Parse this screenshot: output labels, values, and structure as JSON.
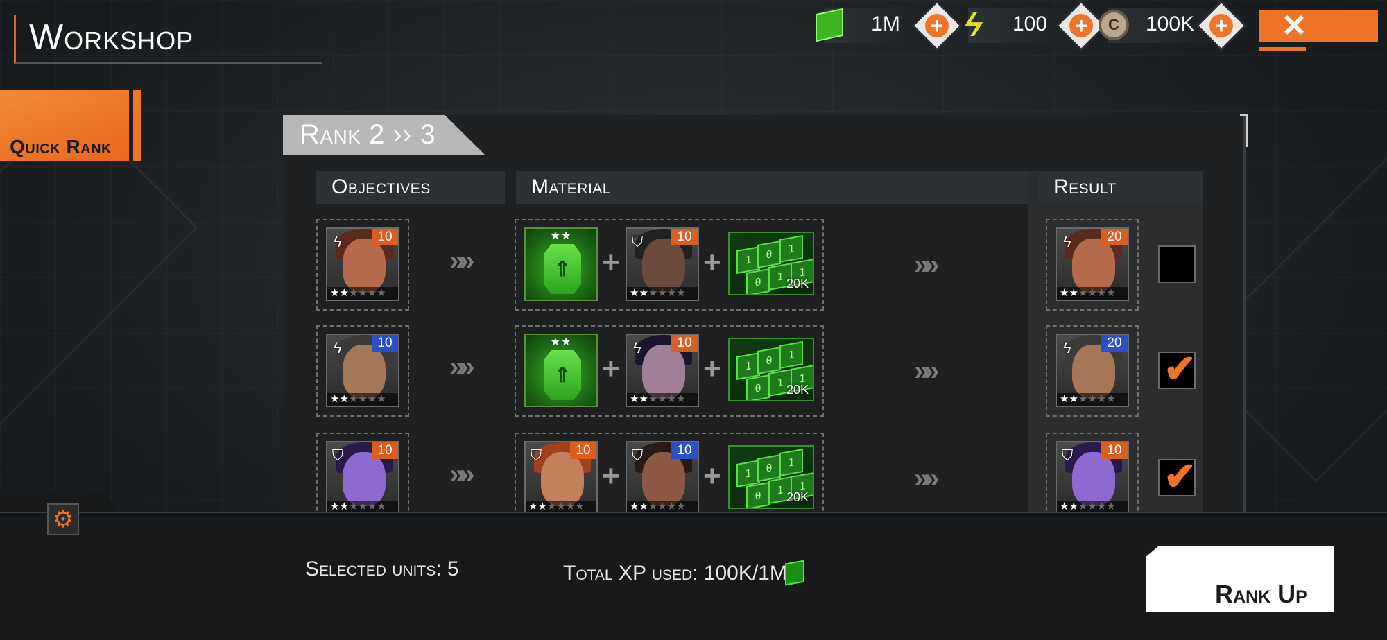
{
  "header": {
    "title": "Workshop",
    "close_icon": "close-icon"
  },
  "resources": [
    {
      "name": "xp-dice",
      "value": "1M",
      "icon": "green-dice-icon",
      "color": "#3db424"
    },
    {
      "name": "energy",
      "value": "100",
      "icon": "lightning-icon",
      "color": "#e0e02a"
    },
    {
      "name": "credits",
      "value": "100K",
      "icon": "credit-coin-icon",
      "color": "#b8a892"
    }
  ],
  "sidebar": {
    "quick_rank_label": "Quick Rank"
  },
  "panel": {
    "rank_label": "Rank 2 ›› 3",
    "columns": {
      "objectives": "Objectives",
      "material": "Material",
      "result": "Result"
    }
  },
  "rows": [
    {
      "objective": {
        "level": "10",
        "level_color": "orange",
        "class_icon": "lightning-class-icon",
        "stars": 2,
        "skin": "#b56a4c",
        "hair": "#5a2a1c"
      },
      "material_item": {
        "stars": "★★"
      },
      "material_unit": {
        "level": "10",
        "level_color": "orange",
        "class_icon": "shield-class-icon",
        "stars": 2,
        "skin": "#6a4a3a",
        "hair": "#222"
      },
      "material_dice_amount": "20K",
      "result": {
        "level": "20",
        "level_color": "orange",
        "class_icon": "lightning-class-icon",
        "stars": 2,
        "skin": "#b56a4c",
        "hair": "#5a2a1c"
      },
      "checked": false
    },
    {
      "objective": {
        "level": "10",
        "level_color": "blue",
        "class_icon": "lightning-class-icon",
        "stars": 2,
        "skin": "#a47856",
        "hair": "#3a3a3a"
      },
      "material_item": {
        "stars": "★★"
      },
      "material_unit": {
        "level": "10",
        "level_color": "orange",
        "class_icon": "lightning-class-icon",
        "stars": 2,
        "skin": "#a08098",
        "hair": "#1c1430"
      },
      "material_dice_amount": "20K",
      "result": {
        "level": "20",
        "level_color": "blue",
        "class_icon": "lightning-class-icon",
        "stars": 2,
        "skin": "#a47856",
        "hair": "#3a3a3a"
      },
      "checked": true
    },
    {
      "objective": {
        "level": "10",
        "level_color": "orange",
        "class_icon": "shield-class-icon",
        "stars": 2,
        "skin": "#8c6ad0",
        "hair": "#2a1a4a"
      },
      "material_item": null,
      "material_unit_a": {
        "level": "10",
        "level_color": "orange",
        "class_icon": "shield-class-icon",
        "stars": 2,
        "skin": "#c4805c",
        "hair": "#a0401c"
      },
      "material_unit": {
        "level": "10",
        "level_color": "blue",
        "class_icon": "shield-class-icon",
        "stars": 2,
        "skin": "#8c5a44",
        "hair": "#2a1a14"
      },
      "material_dice_amount": "20K",
      "result": {
        "level": "10",
        "level_color": "orange",
        "class_icon": "shield-class-icon",
        "stars": 2,
        "skin": "#8c6ad0",
        "hair": "#2a1a4a"
      },
      "checked": true
    }
  ],
  "footer": {
    "selected_units": "Selected units: 5",
    "total_xp": "Total XP used: 100K/1M",
    "rank_up_label": "Rank Up",
    "settings_icon": "gear-icon"
  },
  "colors": {
    "accent": "#ef7428",
    "panel": "#1f2021"
  }
}
